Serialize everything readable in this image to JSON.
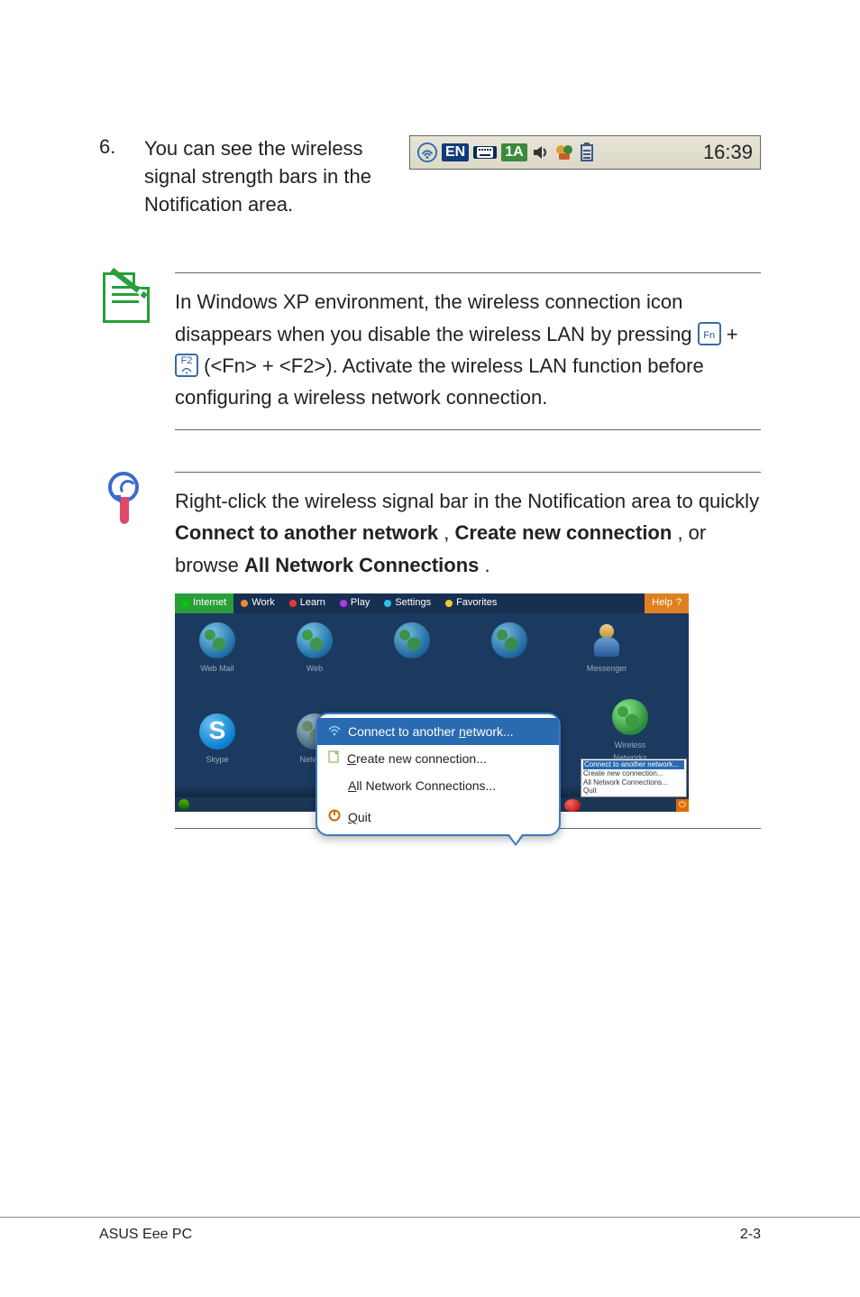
{
  "step6": {
    "number": "6.",
    "text": "You can see the wireless signal strength bars in the Notification area.",
    "tray": {
      "time": "16:39"
    }
  },
  "note1": {
    "line1": "In Windows XP environment, the wireless connection icon disappears when you disable the wireless LAN by pressing ",
    "fn_key": "Fn",
    "plus": " + ",
    "f2_key": "F2",
    "line2": " (<Fn> + <F2>). Activate the wireless LAN function before configuring a wireless network connection."
  },
  "tip1": {
    "text_before": "Right-click the wireless signal bar in the Notification area to quickly ",
    "b1": "Connect to another network",
    "sep1": ", ",
    "b2": "Create new connection",
    "sep2": ", or browse ",
    "b3": "All Network Connections",
    "end": "."
  },
  "screenshot": {
    "tabs": {
      "internet": "Internet",
      "work": "Work",
      "learn": "Learn",
      "play": "Play",
      "settings": "Settings",
      "favorites": "Favorites",
      "help": "Help"
    },
    "icons": {
      "webmail": "Web Mail",
      "web": "Web",
      "messenger": "Messenger",
      "skype": "Skype",
      "network": "Network",
      "wireless": "Wireless Networks"
    },
    "context": {
      "item1": "Connect to another network...",
      "item2": "Create new connection...",
      "item3": "All Network Connections...",
      "item4": "Quit",
      "u1": "n",
      "u2": "C",
      "u3": "A",
      "u4": "Q"
    },
    "mini_tooltip": {
      "hi": "Connect to another network...",
      "l2": "Create new connection...",
      "l3": "All Network Connections...",
      "l4": "Quit"
    }
  },
  "footer": {
    "left": "ASUS Eee PC",
    "right": "2-3"
  }
}
